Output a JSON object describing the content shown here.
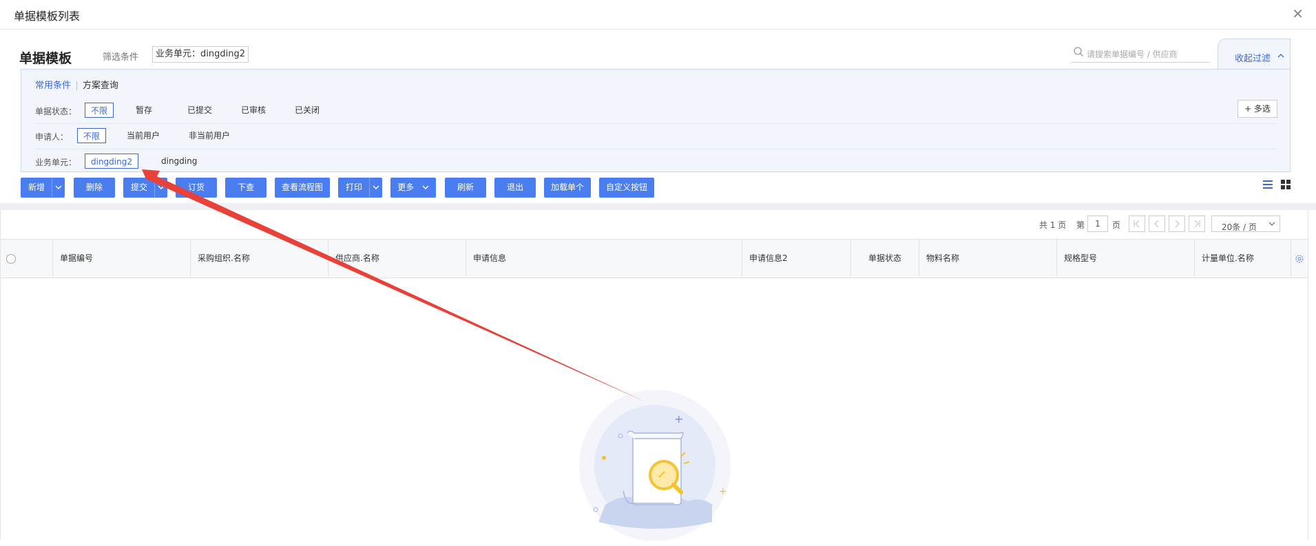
{
  "window": {
    "title": "单据模板列表"
  },
  "header": {
    "page_title": "单据模板",
    "filter_caption": "筛选条件",
    "filter_tag": "业务单元：dingding2",
    "search_placeholder": "请搜索单据编号 / 供应商",
    "collapse_label": "收起过滤"
  },
  "filters": {
    "tabs": [
      "常用条件",
      "方案查询"
    ],
    "multi_select": "+ 多选",
    "rows": [
      {
        "label": "单据状态：",
        "options": [
          "不限",
          "暂存",
          "已提交",
          "已审核",
          "已关闭"
        ],
        "selected": "不限"
      },
      {
        "label": "申请人：",
        "options": [
          "不限",
          "当前用户",
          "非当前用户"
        ],
        "selected": "不限"
      },
      {
        "label": "业务单元：",
        "options": [
          "dingding2",
          "dingding"
        ],
        "selected": "dingding2"
      }
    ]
  },
  "toolbar": {
    "buttons": [
      "新增",
      "删除",
      "提交",
      "订货",
      "下查",
      "查看流程图",
      "打印",
      "更多",
      "刷新",
      "退出",
      "加载单个",
      "自定义按钮"
    ]
  },
  "pager": {
    "total_pages": "共 1 页",
    "page_prefix": "第",
    "current_page": "1",
    "page_suffix": "页",
    "page_size": "20条 / 页"
  },
  "table": {
    "columns": [
      "单据编号",
      "采购组织.名称",
      "供应商.名称",
      "申请信息",
      "申请信息2",
      "单据状态",
      "物料名称",
      "规格型号",
      "计量单位.名称"
    ]
  },
  "colors": {
    "accent": "#4a7ef0",
    "link": "#3b67d6",
    "annotation_arrow": "#e8413a"
  }
}
